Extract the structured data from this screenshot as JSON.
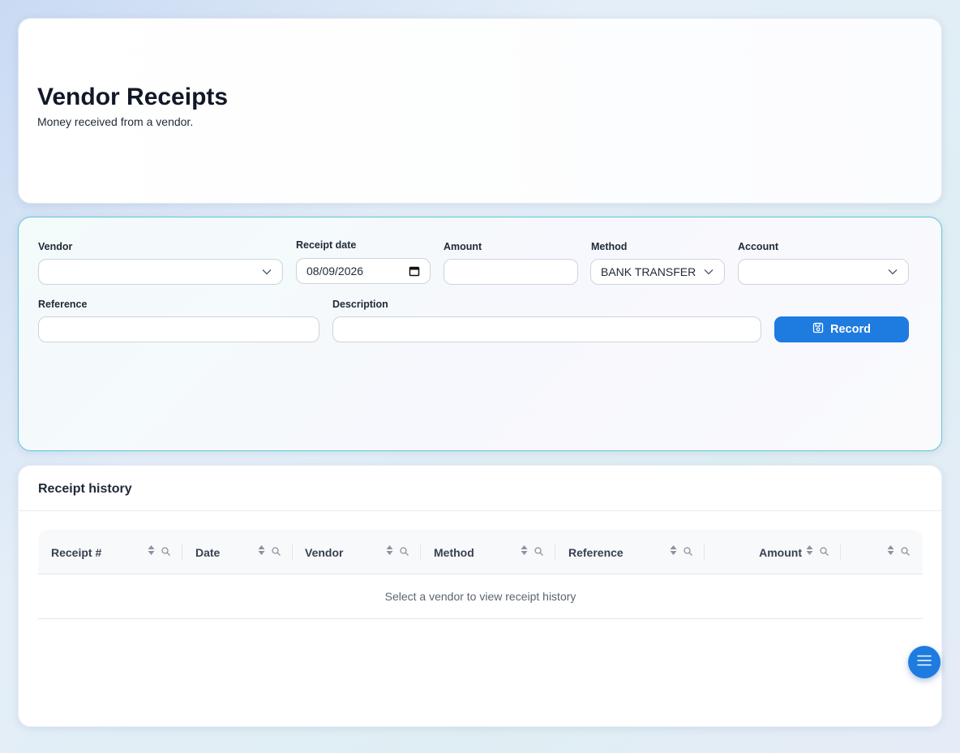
{
  "header": {
    "title": "Vendor Receipts",
    "subtitle": "Money received from a vendor."
  },
  "form": {
    "vendor": {
      "label": "Vendor",
      "value": ""
    },
    "receipt_date": {
      "label": "Receipt date",
      "value": "08/09/2026"
    },
    "amount": {
      "label": "Amount",
      "value": ""
    },
    "method": {
      "label": "Method",
      "value": "BANK TRANSFER"
    },
    "account": {
      "label": "Account",
      "value": ""
    },
    "reference": {
      "label": "Reference",
      "value": ""
    },
    "description": {
      "label": "Description",
      "value": ""
    },
    "record_button": "Record"
  },
  "history": {
    "title": "Receipt history",
    "columns": [
      "Receipt #",
      "Date",
      "Vendor",
      "Method",
      "Reference",
      "Amount",
      ""
    ],
    "empty_message": "Select a vendor to view receipt history"
  },
  "colors": {
    "accent": "#1e7be0",
    "form_border": "#5ec6d9"
  },
  "icons": {
    "dropdown": "chevron-down-icon",
    "date": "calendar-icon",
    "record": "save-icon",
    "sort": "sort-icon",
    "filter": "search-icon",
    "fab": "menu-icon"
  }
}
